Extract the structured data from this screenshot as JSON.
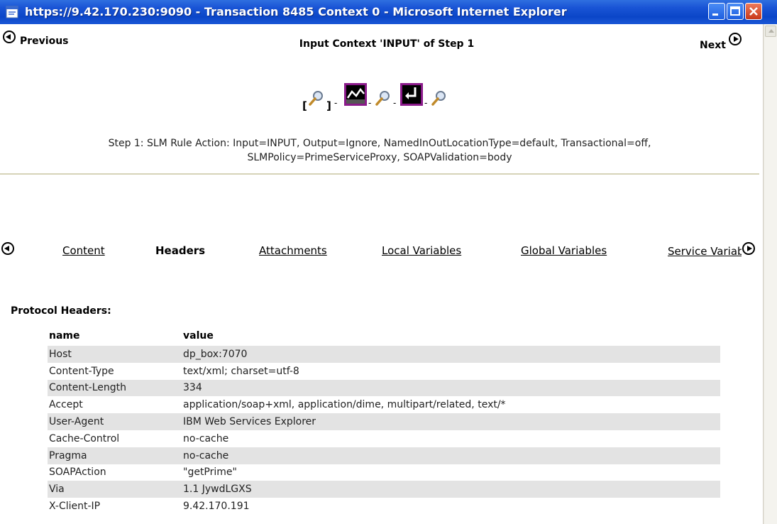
{
  "window": {
    "title": "https://9.42.170.230:9090 - Transaction 8485 Context 0 - Microsoft Internet Explorer",
    "controls": [
      "minimize",
      "maximize",
      "close"
    ]
  },
  "nav": {
    "previous_label": "Previous",
    "next_label": "Next",
    "context_title": "Input Context 'INPUT' of Step 1"
  },
  "step_icons": {
    "open_bracket": "[",
    "close_bracket": "]",
    "dash": "-",
    "icons": [
      "magnifier-icon",
      "action-graph-icon",
      "magnifier-icon",
      "return-arrow-icon",
      "magnifier-icon"
    ]
  },
  "step": {
    "line1": "Step 1: SLM Rule Action: Input=INPUT, Output=Ignore, NamedInOutLocationType=default, Transactional=off,",
    "line2": "SLMPolicy=PrimeServiceProxy, SOAPValidation=body"
  },
  "tabs": {
    "items": [
      {
        "label": "Content",
        "active": false
      },
      {
        "label": "Headers",
        "active": true
      },
      {
        "label": "Attachments",
        "active": false
      },
      {
        "label": "Local Variables",
        "active": false
      },
      {
        "label": "Global Variables",
        "active": false
      },
      {
        "label": "Service Variables",
        "active": false
      }
    ]
  },
  "protocol_headers": {
    "label": "Protocol Headers:",
    "columns": [
      "name",
      "value"
    ],
    "rows": [
      {
        "name": "Host",
        "value": "dp_box:7070"
      },
      {
        "name": "Content-Type",
        "value": "text/xml; charset=utf-8"
      },
      {
        "name": "Content-Length",
        "value": "334"
      },
      {
        "name": "Accept",
        "value": "application/soap+xml, application/dime, multipart/related, text/*"
      },
      {
        "name": "User-Agent",
        "value": "IBM Web Services Explorer"
      },
      {
        "name": "Cache-Control",
        "value": "no-cache"
      },
      {
        "name": "Pragma",
        "value": "no-cache"
      },
      {
        "name": "SOAPAction",
        "value": "\"getPrime\""
      },
      {
        "name": "Via",
        "value": "1.1 JywdLGXS"
      },
      {
        "name": "X-Client-IP",
        "value": "9.42.170.191"
      }
    ]
  },
  "colors": {
    "titlebar": "#0b46c8",
    "row_shade": "#e3e3e3",
    "icon_border": "#8a1a8a"
  }
}
